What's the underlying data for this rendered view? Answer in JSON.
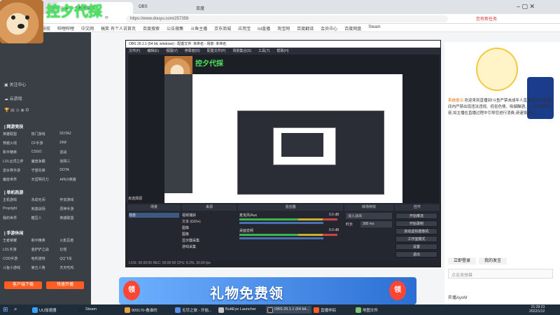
{
  "browser": {
    "tabs": [
      "斗鱼·一个都不能少...",
      "OBS",
      "百度"
    ],
    "url": "https://www.douyu.com/257359",
    "bookmarks": [
      "导航",
      "哔哩哔哩",
      "中文网",
      "搞笑·有个人说首页",
      "百度搜索",
      "公告搜集",
      "斗鱼主播",
      "京东商城",
      "应用宝",
      "lol直播",
      "淘宝网",
      "百度翻译",
      "会员中心",
      "百度网盘",
      "Steam"
    ],
    "right_top_text": "您有新任务"
  },
  "stream": {
    "title": "控夕代採",
    "dog_label": "doge"
  },
  "sidebar": {
    "items": [
      {
        "label": "关注中心"
      },
      {
        "label": "云游戏"
      }
    ],
    "sections": [
      {
        "title": "| 网游竞技",
        "games": [
          "英雄联盟",
          "热门游戏",
          "DOTA2",
          "穿越火线",
          "CF手游",
          "DNF",
          "和平精英",
          "CSGO",
          "逆战",
          "LOL云顶之弈",
          "魔兽争霸",
          "剑网三",
          "逆水寒手游",
          "守望先锋",
          "DOTA",
          "魔兽世界",
          "天涯明月刀",
          "APEX英雄"
        ]
      },
      {
        "title": "| 单机热游",
        "games": [
          "主机游戏",
          "永劫无间",
          "怀旧游戏",
          "Proyright",
          "刺激战场",
          "原神手游",
          "我的世界",
          "糖豆人",
          "英雄联盟"
        ]
      },
      {
        "title": "| 手游休闲",
        "games": [
          "王者荣耀",
          "和平精英",
          "火影忍者",
          "LOL手游",
          "金铲铲之战",
          "幻塔",
          "COD手游",
          "哈利波特",
          "QQ飞车",
          "斗鱼小游戏",
          "第五人格",
          "天天吃鸡"
        ]
      }
    ],
    "buttons": [
      "客户端下载",
      "快速开播"
    ]
  },
  "chat": {
    "notice_label": "系统提示:",
    "notice_text": "欢迎来到直播间!斗鱼严禁未成年人直播或打赏,直播间内严禁出现违法违规、低俗色情、吸烟酗酒、人身伤害等内容,如主播在直播过程中引导您进行消费,请谨慎辨识。",
    "chips": [
      "立即登录",
      "我的发言"
    ],
    "box_text": "点击发弹幕",
    "user": "弈播AyoM",
    "time_text": "2022/1/12"
  },
  "obs": {
    "title": "OBS 26.1.1 (64 bit, windows) - 配置文件: 未命名 - 场景: 未命名",
    "menu": [
      "文件(F)",
      "编辑(E)",
      "视图(V)",
      "停靠窗(D)",
      "配置文件(P)",
      "场景集合(S)",
      "工具(T)",
      "帮助(H)"
    ],
    "inner_stream_title": "控夕代採",
    "no_source_label": "未选择源",
    "dock_headers": [
      "场景",
      "来源",
      "混音器",
      "转场特效",
      "控件"
    ],
    "scene": "场景",
    "sources": [
      "视频捕获",
      "文本 (GDI+)",
      "图像",
      "图像",
      "显示器采集",
      "游戏采集"
    ],
    "mixer": [
      {
        "name": "麦克风/Aux",
        "db": "0.0 dB"
      },
      {
        "name": "桌面音频",
        "db": "0.0 dB"
      }
    ],
    "transition": "淡入淡出",
    "duration_label": "时长",
    "duration": "300 ms",
    "controls": [
      "开始推流",
      "开始录制",
      "启动虚拟摄像机",
      "工作室模式",
      "设置",
      "退出"
    ],
    "status": "LIVE: 00:00:00    REC: 00:00:00    CPU: 8.3%, 30.00 fps"
  },
  "banner": {
    "text": "礼物免费领",
    "ling": "领"
  },
  "taskbar": {
    "items": [
      "UU加速器",
      "Steam",
      "909170-看谁的",
      "无尽之旅 - 开始...",
      "ButtEye Launcher",
      "OBS 26.1.1 (64 bit...",
      "直播伴侣",
      "地图文件"
    ],
    "time": "21:29:23",
    "date": "2022/1/12"
  },
  "colors": {
    "douyu_orange": "#ff7700",
    "obs_bg": "#2b2e38",
    "stream_title_green": "#4de35a"
  }
}
